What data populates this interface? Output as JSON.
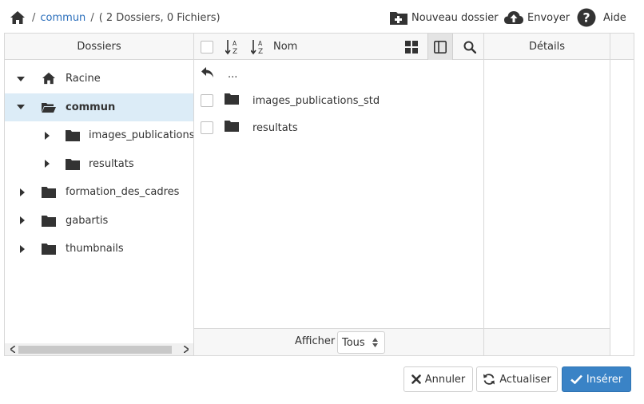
{
  "breadcrumb": {
    "separator": "/",
    "current_folder": "commun",
    "summary": "( 2 Dossiers, 0 Fichiers)"
  },
  "toolbar": {
    "new_folder_label": "Nouveau dossier",
    "upload_label": "Envoyer",
    "help_label": "Aide"
  },
  "folders_pane": {
    "title": "Dossiers",
    "tree": [
      {
        "label": "Racine",
        "icon": "home-icon",
        "expanded": true
      },
      {
        "label": "commun",
        "icon": "folder-open-icon",
        "expanded": true,
        "selected": true
      },
      {
        "label": "images_publications_std",
        "icon": "folder-icon",
        "expanded": false
      },
      {
        "label": "resultats",
        "icon": "folder-icon",
        "expanded": false
      },
      {
        "label": "formation_des_cadres",
        "icon": "folder-icon",
        "expanded": false
      },
      {
        "label": "gabartis",
        "icon": "folder-icon",
        "expanded": false
      },
      {
        "label": "thumbnails",
        "icon": "folder-icon",
        "expanded": false
      }
    ]
  },
  "list_pane": {
    "name_column": "Nom",
    "up_row_label": "...",
    "items": [
      {
        "name": "images_publications_std",
        "icon": "folder-icon"
      },
      {
        "name": "resultats",
        "icon": "folder-icon"
      }
    ],
    "footer": {
      "show_label": "Afficher",
      "show_value": "Tous"
    }
  },
  "details_pane": {
    "title": "Détails"
  },
  "buttons": {
    "cancel": "Annuler",
    "refresh": "Actualiser",
    "insert": "Insérer"
  },
  "colors": {
    "link": "#2a6ebb",
    "selected_row": "#dcecf7",
    "primary_button": "#3a83c6",
    "icon": "#333333"
  }
}
